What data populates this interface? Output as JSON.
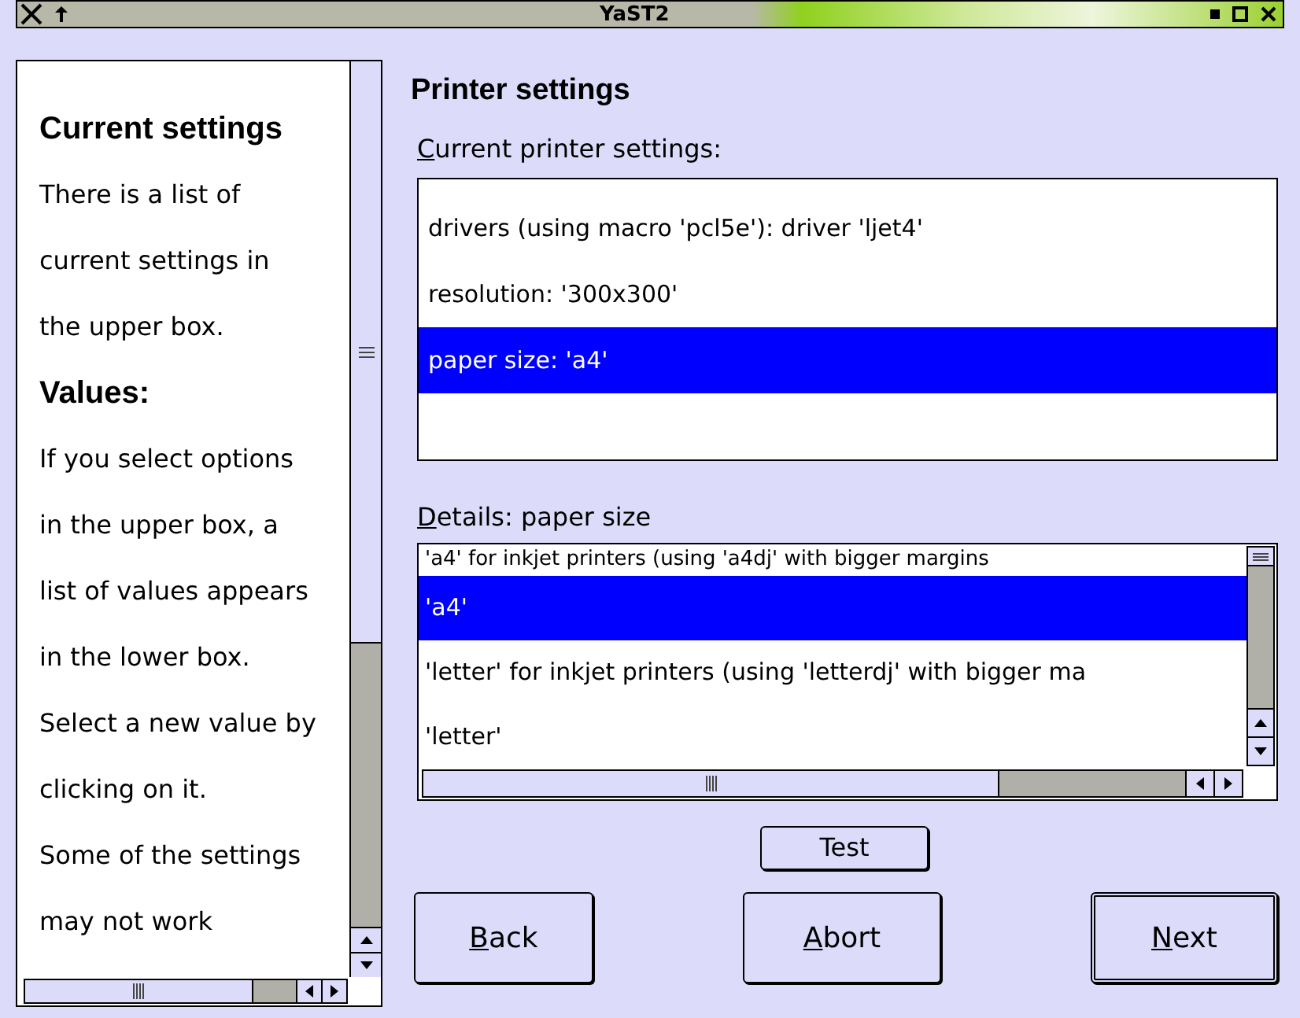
{
  "window": {
    "title": "YaST2"
  },
  "help": {
    "blocks": [
      {
        "kind": "heading",
        "lines": [
          "Current settings"
        ]
      },
      {
        "kind": "text",
        "lines": [
          "There is a list of",
          "current settings in",
          "the upper box."
        ]
      },
      {
        "kind": "heading",
        "lines": [
          "Values:"
        ]
      },
      {
        "kind": "text",
        "lines": [
          "If you select options",
          "in the upper box, a",
          "list of values appears",
          "in the lower box."
        ]
      },
      {
        "kind": "text",
        "lines": [
          "Select a new value by",
          "clicking on it."
        ]
      },
      {
        "kind": "text",
        "lines": [
          "Some of the settings",
          "may not work"
        ]
      }
    ]
  },
  "title": "Printer settings",
  "current": {
    "label": "Current printer settings:",
    "underline_first": true,
    "rows": [
      {
        "text": "drivers (using macro 'pcl5e'): driver 'ljet4'",
        "selected": false
      },
      {
        "text": "resolution: '300x300'",
        "selected": false
      },
      {
        "text": "paper size: 'a4'",
        "selected": true
      }
    ]
  },
  "details": {
    "label": "Details: paper size",
    "underline_first": true,
    "rows": [
      {
        "text": "'a4'  for inkjet printers (using 'a4dj' with bigger margins",
        "selected": false
      },
      {
        "text": "'a4'",
        "selected": true
      },
      {
        "text": "'letter'  for inkjet printers (using 'letterdj' with bigger ma",
        "selected": false
      },
      {
        "text": "'letter'",
        "selected": false
      }
    ]
  },
  "test_button": {
    "label": "Test",
    "underline_first": false
  },
  "buttons": [
    {
      "label": "Back",
      "underline_first": true,
      "default": false
    },
    {
      "label": "Abort",
      "underline_first": true,
      "default": false
    },
    {
      "label": "Next",
      "underline_first": true,
      "default": true
    }
  ]
}
